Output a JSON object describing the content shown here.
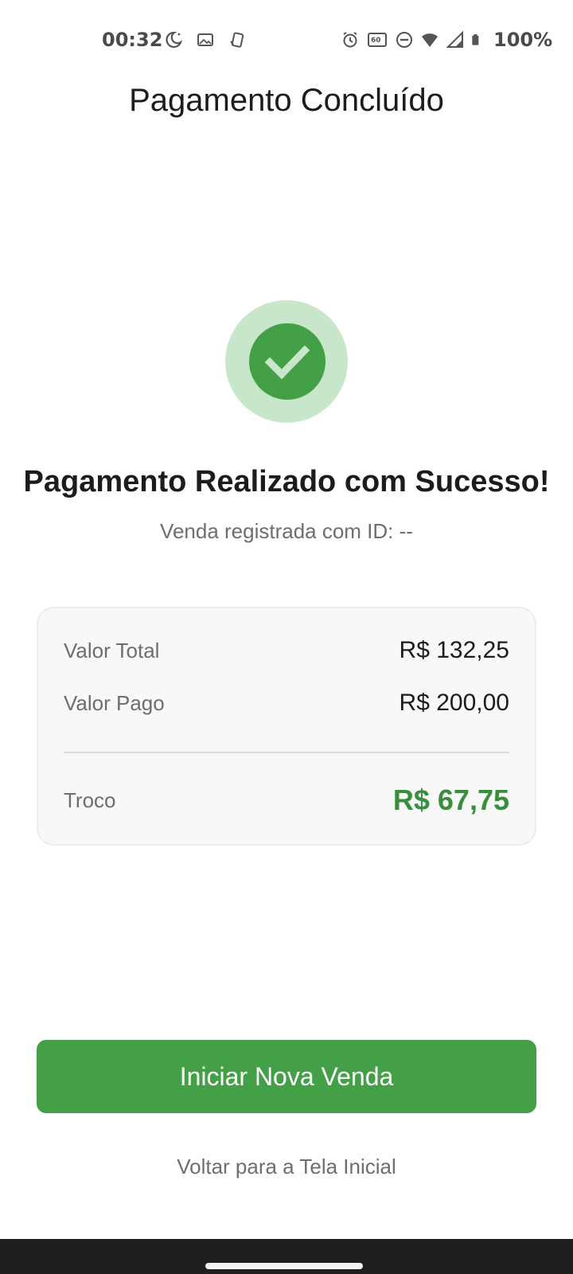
{
  "status_bar": {
    "time": "00:32",
    "battery": "100%",
    "icons_left": [
      "do-not-disturb-moon-icon",
      "gallery-icon",
      "pickup-icon"
    ],
    "icons_right": [
      "alarm-icon",
      "refresh-rate-60hz-icon",
      "dnd-icon",
      "wifi-icon",
      "signal-icon",
      "battery-icon"
    ]
  },
  "header": {
    "title": "Pagamento Concluído"
  },
  "success": {
    "icon": "check-circle-icon",
    "title": "Pagamento Realizado com Sucesso!",
    "sale_id_text": "Venda registrada com ID: --"
  },
  "summary": {
    "total_label": "Valor Total",
    "total_value": "R$ 132,25",
    "paid_label": "Valor Pago",
    "paid_value": "R$ 200,00",
    "change_label": "Troco",
    "change_value": "R$ 67,75"
  },
  "actions": {
    "primary_label": "Iniciar Nova Venda",
    "secondary_label": "Voltar para a Tela Inicial"
  },
  "colors": {
    "accent_green": "#43a047",
    "change_green": "#388e3c",
    "success_halo": "#c8e6c9"
  }
}
